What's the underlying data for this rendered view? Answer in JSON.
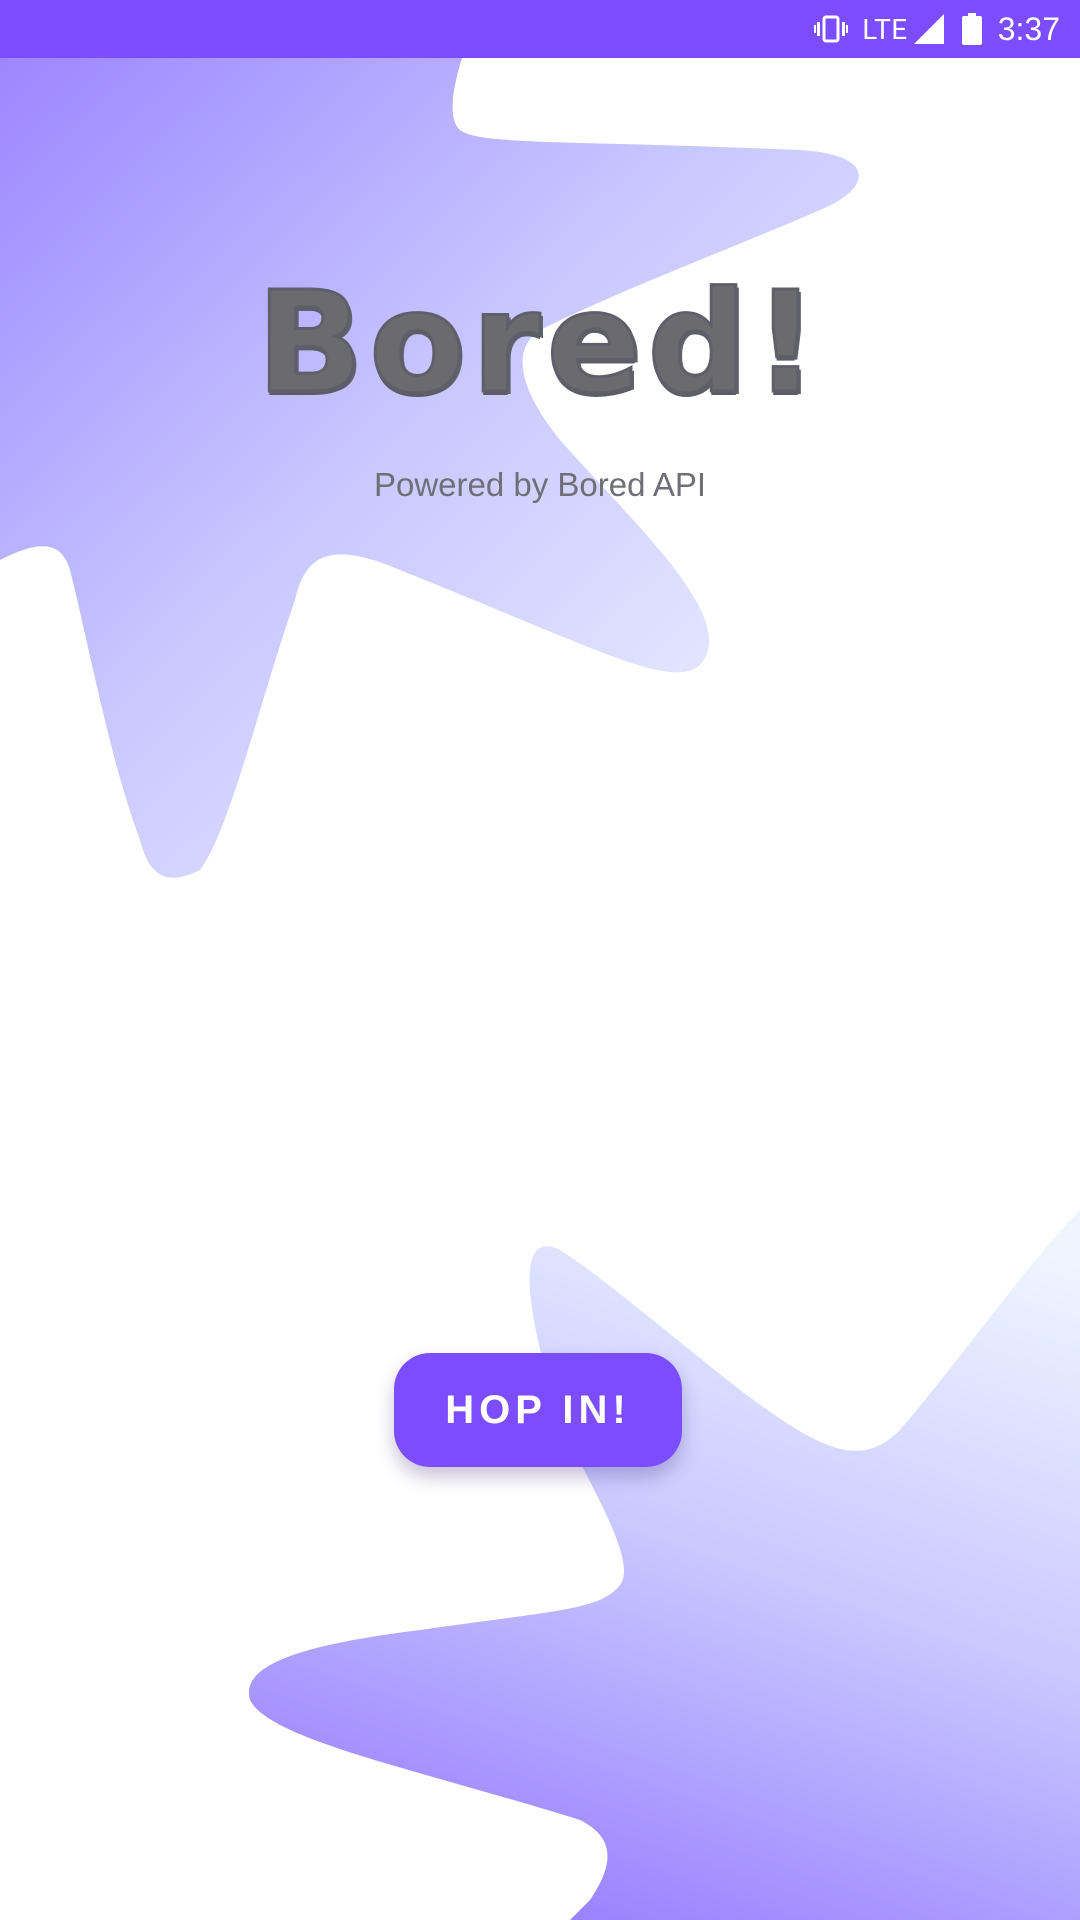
{
  "status_bar": {
    "network": "LTE",
    "time": "3:37",
    "icons": [
      "vibrate-icon",
      "signal-icon",
      "battery-icon"
    ]
  },
  "main": {
    "title": "Bored!",
    "subtitle": "Powered by Bored API"
  },
  "cta": {
    "label": "HOP IN!"
  },
  "colors": {
    "accent": "#7c4dff",
    "title": "#6b6b6f",
    "subtitle": "#6f6f78",
    "blob_dark": "#9f85ff",
    "blob_light": "#eaf2ff"
  }
}
